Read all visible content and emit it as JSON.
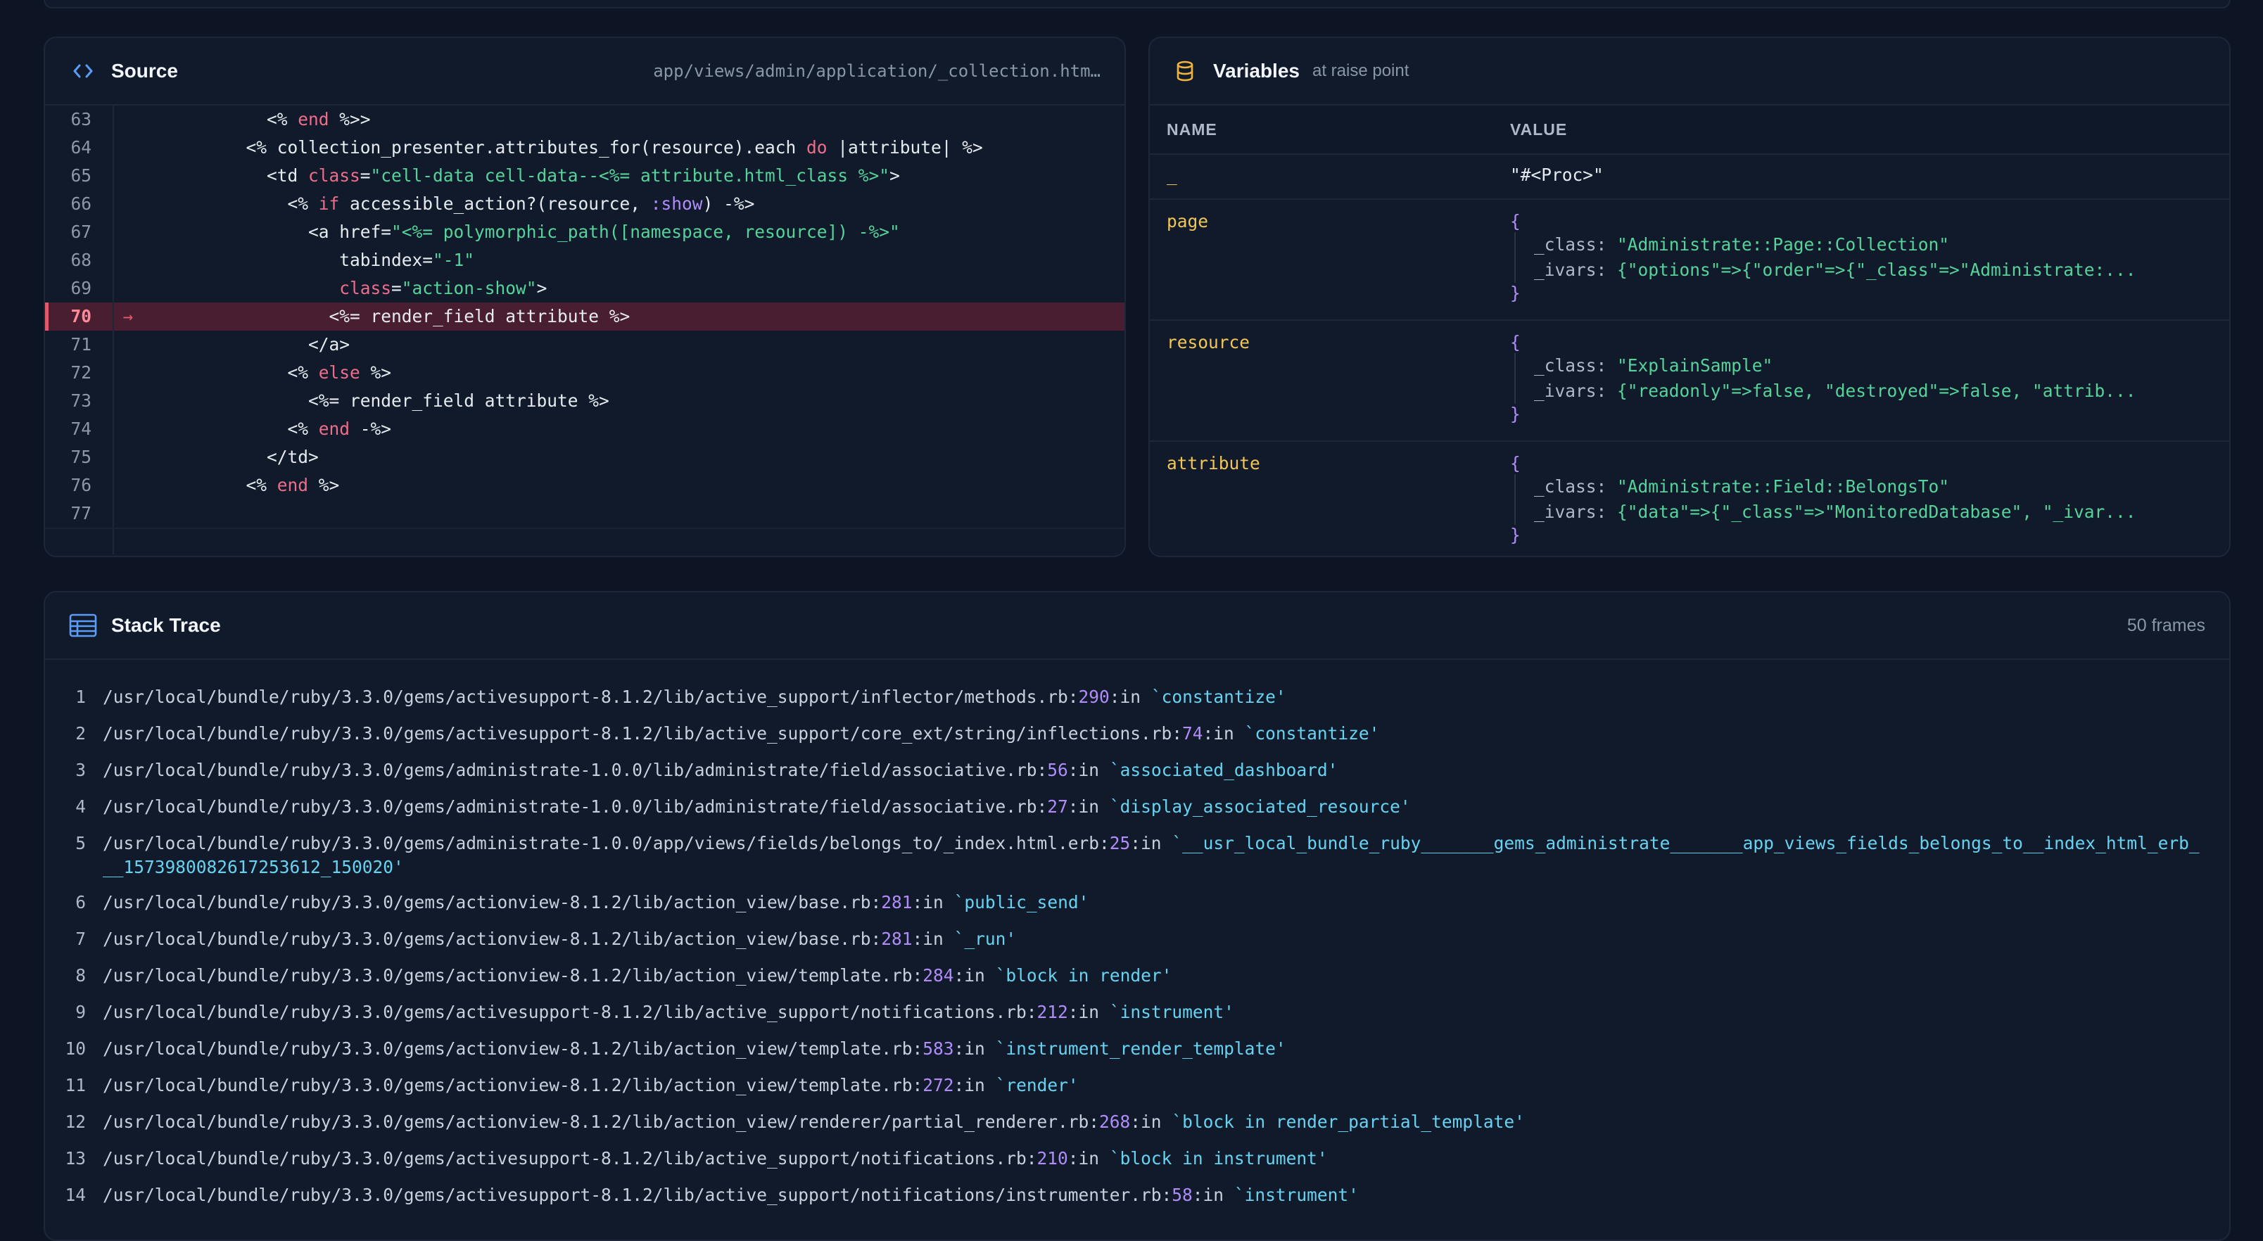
{
  "source": {
    "title": "Source",
    "file": "app/views/admin/application/_collection.htm…",
    "highlight_line": "70",
    "lines": [
      {
        "n": "63",
        "html": "            &lt;% <span class=\"kw\">end</span> %&gt;&gt;"
      },
      {
        "n": "64",
        "html": "          &lt;% collection_presenter.attributes_for(resource).each <span class=\"kw\">do</span> |attribute| %&gt;"
      },
      {
        "n": "65",
        "html": "            &lt;td <span class=\"kw\">class</span>=<span class=\"str\">\"cell-data cell-data--&lt;%= attribute.html_class %&gt;\"</span>&gt;"
      },
      {
        "n": "66",
        "html": "              &lt;% <span class=\"kw\">if</span> accessible_action?(resource, <span class=\"sym\">:show</span>) -%&gt;"
      },
      {
        "n": "67",
        "html": "                &lt;a href=<span class=\"str\">\"&lt;%= polymorphic_path([namespace, resource]) -%&gt;\"</span>"
      },
      {
        "n": "68",
        "html": "                   tabindex=<span class=\"str\">\"-1\"</span>"
      },
      {
        "n": "69",
        "html": "                   <span class=\"kw\">class</span>=<span class=\"str\">\"action-show\"</span>&gt;"
      },
      {
        "n": "70",
        "html": "                  &lt;%= render_field attribute %&gt;"
      },
      {
        "n": "71",
        "html": "                &lt;/a&gt;"
      },
      {
        "n": "72",
        "html": "              &lt;% <span class=\"kw\">else</span> %&gt;"
      },
      {
        "n": "73",
        "html": "                &lt;%= render_field attribute %&gt;"
      },
      {
        "n": "74",
        "html": "              &lt;% <span class=\"kw\">end</span> -%&gt;"
      },
      {
        "n": "75",
        "html": "            &lt;/td&gt;"
      },
      {
        "n": "76",
        "html": "          &lt;% <span class=\"kw\">end</span> %&gt;"
      },
      {
        "n": "77",
        "html": ""
      }
    ]
  },
  "variables": {
    "title": "Variables",
    "subtitle": "at raise point",
    "col_name": "NAME",
    "col_value": "VALUE",
    "rows": [
      {
        "name": "_",
        "simple": "\"#<Proc>\""
      },
      {
        "name": "page",
        "class": "\"Administrate::Page::Collection\"",
        "ivars": "{\"options\"=>{\"order\"=>{\"_class\"=>\"Administrate:..."
      },
      {
        "name": "resource",
        "class": "\"ExplainSample\"",
        "ivars": "{\"readonly\"=>false, \"destroyed\"=>false, \"attrib..."
      },
      {
        "name": "attribute",
        "class": "\"Administrate::Field::BelongsTo\"",
        "ivars": "{\"data\"=>{\"_class\"=>\"MonitoredDatabase\", \"_ivar..."
      }
    ],
    "class_key": "_class: ",
    "ivars_key": "_ivars: ",
    "brace_open": "{",
    "brace_close": "}"
  },
  "stack": {
    "title": "Stack Trace",
    "count": "50 frames",
    "frames": [
      {
        "n": "1",
        "path": "/usr/local/bundle/ruby/3.3.0/gems/activesupport-8.1.2/lib/active_support/inflector/methods.rb:",
        "line": "290",
        "mid": ":in ",
        "meth": "`constantize'"
      },
      {
        "n": "2",
        "path": "/usr/local/bundle/ruby/3.3.0/gems/activesupport-8.1.2/lib/active_support/core_ext/string/inflections.rb:",
        "line": "74",
        "mid": ":in ",
        "meth": "`constantize'"
      },
      {
        "n": "3",
        "path": "/usr/local/bundle/ruby/3.3.0/gems/administrate-1.0.0/lib/administrate/field/associative.rb:",
        "line": "56",
        "mid": ":in ",
        "meth": "`associated_dashboard'"
      },
      {
        "n": "4",
        "path": "/usr/local/bundle/ruby/3.3.0/gems/administrate-1.0.0/lib/administrate/field/associative.rb:",
        "line": "27",
        "mid": ":in ",
        "meth": "`display_associated_resource'"
      },
      {
        "n": "5",
        "path": "/usr/local/bundle/ruby/3.3.0/gems/administrate-1.0.0/app/views/fields/belongs_to/_index.html.erb:",
        "line": "25",
        "mid": ":in ",
        "meth": "`__usr_local_bundle_ruby_______gems_administrate_______app_views_fields_belongs_to__index_html_erb___1573980082617253612_150020'"
      },
      {
        "n": "6",
        "path": "/usr/local/bundle/ruby/3.3.0/gems/actionview-8.1.2/lib/action_view/base.rb:",
        "line": "281",
        "mid": ":in ",
        "meth": "`public_send'"
      },
      {
        "n": "7",
        "path": "/usr/local/bundle/ruby/3.3.0/gems/actionview-8.1.2/lib/action_view/base.rb:",
        "line": "281",
        "mid": ":in ",
        "meth": "`_run'"
      },
      {
        "n": "8",
        "path": "/usr/local/bundle/ruby/3.3.0/gems/actionview-8.1.2/lib/action_view/template.rb:",
        "line": "284",
        "mid": ":in ",
        "meth": "`block in render'"
      },
      {
        "n": "9",
        "path": "/usr/local/bundle/ruby/3.3.0/gems/activesupport-8.1.2/lib/active_support/notifications.rb:",
        "line": "212",
        "mid": ":in ",
        "meth": "`instrument'"
      },
      {
        "n": "10",
        "path": "/usr/local/bundle/ruby/3.3.0/gems/actionview-8.1.2/lib/action_view/template.rb:",
        "line": "583",
        "mid": ":in ",
        "meth": "`instrument_render_template'"
      },
      {
        "n": "11",
        "path": "/usr/local/bundle/ruby/3.3.0/gems/actionview-8.1.2/lib/action_view/template.rb:",
        "line": "272",
        "mid": ":in ",
        "meth": "`render'"
      },
      {
        "n": "12",
        "path": "/usr/local/bundle/ruby/3.3.0/gems/actionview-8.1.2/lib/action_view/renderer/partial_renderer.rb:",
        "line": "268",
        "mid": ":in ",
        "meth": "`block in render_partial_template'"
      },
      {
        "n": "13",
        "path": "/usr/local/bundle/ruby/3.3.0/gems/activesupport-8.1.2/lib/active_support/notifications.rb:",
        "line": "210",
        "mid": ":in ",
        "meth": "`block in instrument'"
      },
      {
        "n": "14",
        "path": "/usr/local/bundle/ruby/3.3.0/gems/activesupport-8.1.2/lib/active_support/notifications/instrumenter.rb:",
        "line": "58",
        "mid": ":in ",
        "meth": "`instrument'"
      }
    ]
  }
}
